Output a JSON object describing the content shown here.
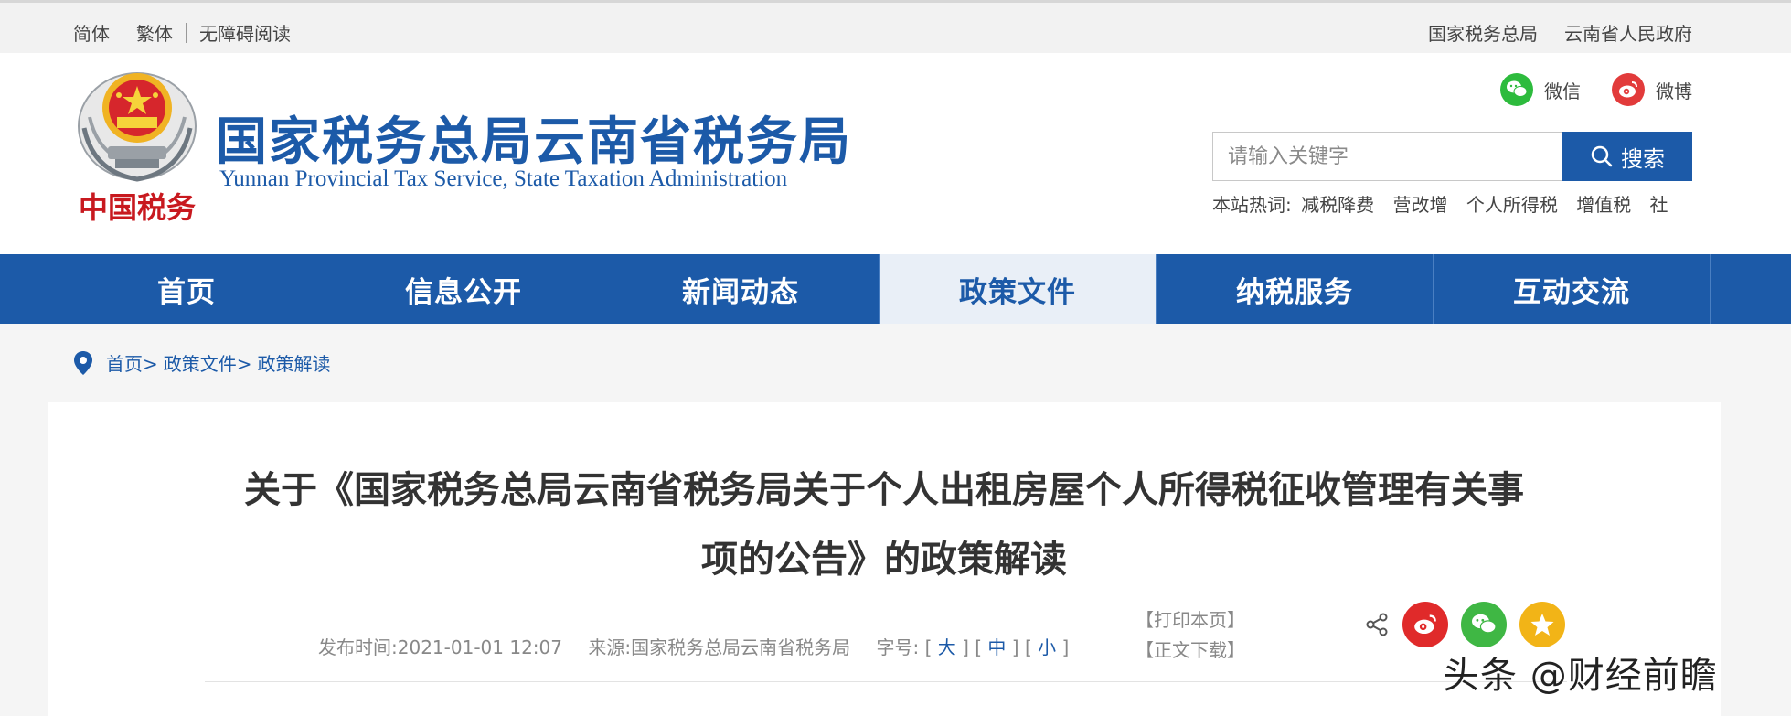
{
  "topbar": {
    "left": [
      "简体",
      "繁体",
      "无障碍阅读"
    ],
    "right": [
      "国家税务总局",
      "云南省人民政府"
    ]
  },
  "header": {
    "title_cn": "国家税务总局云南省税务局",
    "title_en": "Yunnan Provincial Tax Service, State Taxation Administration",
    "emblem_text": "中国税务",
    "social": {
      "wechat": "微信",
      "weibo": "微博"
    },
    "search": {
      "placeholder": "请输入关键字",
      "button": "搜索"
    },
    "hotwords_label": "本站热词:",
    "hotwords": [
      "减税降费",
      "营改增",
      "个人所得税",
      "增值税",
      "社"
    ]
  },
  "nav": {
    "items": [
      "首页",
      "信息公开",
      "新闻动态",
      "政策文件",
      "纳税服务",
      "互动交流"
    ],
    "active_index": 3
  },
  "breadcrumb": [
    "首页>",
    "政策文件>",
    "政策解读"
  ],
  "article": {
    "title_line1": "关于《国家税务总局云南省税务局关于个人出租房屋个人所得税征收管理有关事",
    "title_line2": "项的公告》的政策解读",
    "publish_label": "发布时间:",
    "publish_time": "2021-01-01 12:07",
    "source_label": "来源:",
    "source": "国家税务总局云南省税务局",
    "fontsize_label": "字号:",
    "fontsizes": [
      "大",
      "中",
      "小"
    ],
    "print": "【打印本页】",
    "download": "【正文下载】"
  },
  "watermark": "头条 @财经前瞻",
  "colors": {
    "brand_blue": "#1c5aa8",
    "active_tab_bg": "#e9eff7",
    "wechat_green": "#2dbb3d",
    "weibo_red": "#e23b3b",
    "qzone_yellow": "#f2b417"
  }
}
